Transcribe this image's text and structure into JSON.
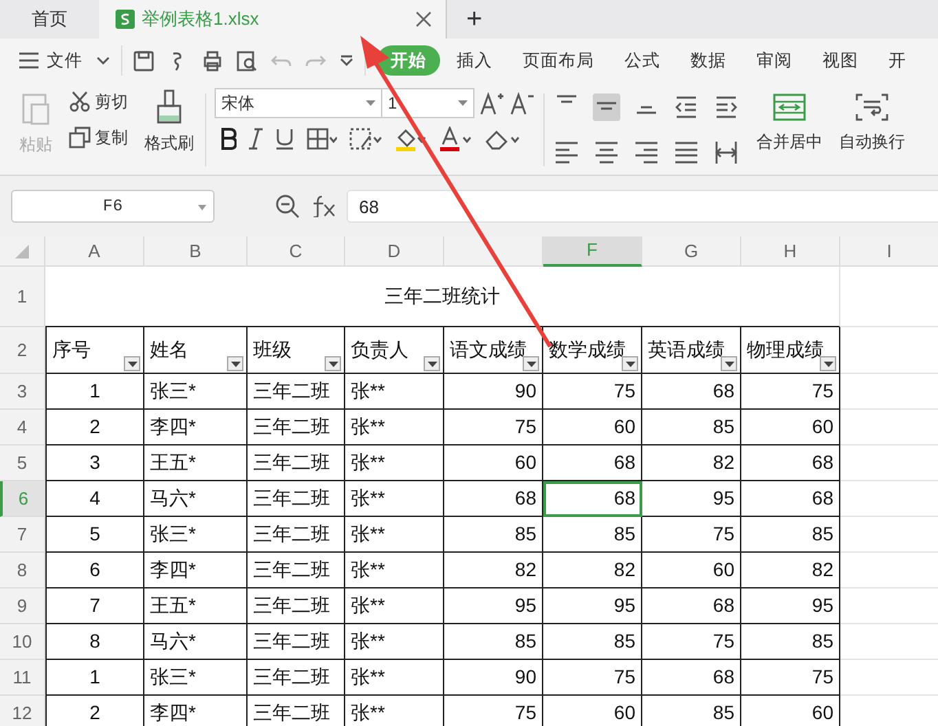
{
  "tabs": [
    {
      "label": "首页",
      "kind": "home",
      "selected": false
    },
    {
      "label": "举例表格1.xlsx",
      "kind": "doc",
      "selected": true
    }
  ],
  "new_tab": "+",
  "menu": {
    "file": "文件",
    "tabs": [
      {
        "label": "开始",
        "selected": true
      },
      {
        "label": "插入",
        "selected": false
      },
      {
        "label": "页面布局",
        "selected": false
      },
      {
        "label": "公式",
        "selected": false
      },
      {
        "label": "数据",
        "selected": false
      },
      {
        "label": "审阅",
        "selected": false
      },
      {
        "label": "视图",
        "selected": false
      },
      {
        "label": "开",
        "selected": false
      }
    ]
  },
  "ribbon": {
    "paste": {
      "label": "粘贴",
      "disabled": true
    },
    "cut": "剪切",
    "copy": "复制",
    "format_painter": "格式刷",
    "font": "宋体",
    "font_size": "1",
    "merge": "合并居中",
    "wrap": "自动换行"
  },
  "name_box": "F6",
  "formula": "68",
  "columns": [
    {
      "label": "A",
      "selected": false
    },
    {
      "label": "B",
      "selected": false
    },
    {
      "label": "C",
      "selected": false
    },
    {
      "label": "D",
      "selected": false
    },
    {
      "selected": false
    },
    {
      "label": "F",
      "selected": true
    },
    {
      "label": "G",
      "selected": false
    },
    {
      "label": "H",
      "selected": false
    },
    {
      "label": "I",
      "selected": false
    }
  ],
  "title_row": {
    "number": "1",
    "text": "三年二班统计"
  },
  "header_row": {
    "number": "2",
    "cells": [
      "序号",
      "姓名",
      "班级",
      "负责人",
      "语文成绩",
      "数学成绩",
      "英语成绩",
      "物理成绩"
    ]
  },
  "rows": [
    {
      "number": "3",
      "selected": false,
      "cells": [
        "1",
        "张三*",
        "三年二班",
        "张**",
        "90",
        "75",
        "68",
        "75"
      ]
    },
    {
      "number": "4",
      "selected": false,
      "cells": [
        "2",
        "李四*",
        "三年二班",
        "张**",
        "75",
        "60",
        "85",
        "60"
      ]
    },
    {
      "number": "5",
      "selected": false,
      "cells": [
        "3",
        "王五*",
        "三年二班",
        "张**",
        "60",
        "68",
        "82",
        "68"
      ]
    },
    {
      "number": "6",
      "selected": true,
      "cells": [
        "4",
        "马六*",
        "三年二班",
        "张**",
        "68",
        "68",
        "95",
        "68"
      ]
    },
    {
      "number": "7",
      "selected": false,
      "cells": [
        "5",
        "张三*",
        "三年二班",
        "张**",
        "85",
        "85",
        "75",
        "85"
      ]
    },
    {
      "number": "8",
      "selected": false,
      "cells": [
        "6",
        "李四*",
        "三年二班",
        "张**",
        "82",
        "82",
        "60",
        "82"
      ]
    },
    {
      "number": "9",
      "selected": false,
      "cells": [
        "7",
        "王五*",
        "三年二班",
        "张**",
        "95",
        "95",
        "68",
        "95"
      ]
    },
    {
      "number": "10",
      "selected": false,
      "cells": [
        "8",
        "马六*",
        "三年二班",
        "张**",
        "85",
        "85",
        "75",
        "85"
      ]
    },
    {
      "number": "11",
      "selected": false,
      "cells": [
        "1",
        "张三*",
        "三年二班",
        "张**",
        "90",
        "75",
        "68",
        "75"
      ]
    },
    {
      "number": "12",
      "selected": false,
      "cells": [
        "2",
        "李四*",
        "三年二班",
        "张**",
        "75",
        "60",
        "85",
        "60"
      ]
    }
  ]
}
